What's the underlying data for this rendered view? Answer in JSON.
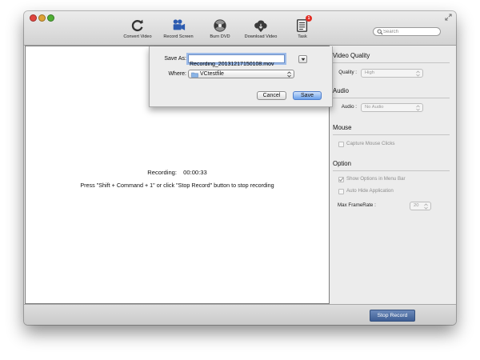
{
  "toolbar": {
    "items": [
      {
        "label": "Convert Video",
        "icon": "convert-video-icon"
      },
      {
        "label": "Record Screen",
        "icon": "record-screen-icon"
      },
      {
        "label": "Burn DVD",
        "icon": "burn-dvd-icon"
      },
      {
        "label": "Download Video",
        "icon": "download-video-icon"
      },
      {
        "label": "Task",
        "icon": "task-icon",
        "badge": "1"
      }
    ],
    "search_placeholder": "Search"
  },
  "recording": {
    "label": "Recording:",
    "time": "00:00:33",
    "hint": "Press \"Shift + Command + 1\" or click \"Stop Record\" button to stop recording"
  },
  "save_sheet": {
    "save_as_label": "Save As:",
    "filename": "Recording_20131217150108.mov",
    "where_label": "Where:",
    "where_value": "VCtestfile",
    "cancel_label": "Cancel",
    "save_label": "Save"
  },
  "sidebar": {
    "video_quality": {
      "title": "Video Quality",
      "label": "Quality :",
      "value": "High"
    },
    "audio": {
      "title": "Audio",
      "label": "Audio :",
      "value": "No Audio"
    },
    "mouse": {
      "title": "Mouse",
      "capture_label": "Capture Mouse Clicks"
    },
    "option": {
      "title": "Option",
      "show_options_label": "Show Options in Menu Bar",
      "auto_hide_label": "Auto Hide Application",
      "framerate_label": "Max FrameRate :",
      "framerate_value": "20"
    }
  },
  "footer": {
    "stop_label": "Stop Record"
  },
  "colors": {
    "accent_blue": "#4f7ecb",
    "stop_button": "#4d6ea4",
    "badge_red": "#e22b22"
  }
}
